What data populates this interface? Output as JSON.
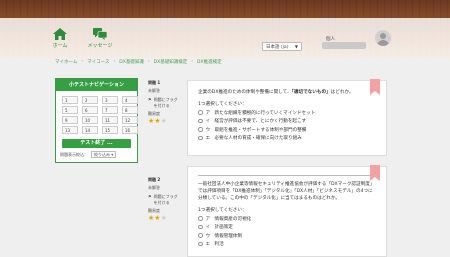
{
  "header": {
    "home_label": "ホーム",
    "message_label": "メッセージ",
    "language": "日本語 (ja)",
    "user_label": "個人"
  },
  "breadcrumb": [
    "マイホーム",
    "マイコース",
    "DX基礎知識",
    "DX基礎知識検定",
    "DX推進検定"
  ],
  "nav": {
    "title": "小テストナビゲーション",
    "cells": [
      "1",
      "2",
      "3",
      "4",
      "5",
      "6",
      "7",
      "8",
      "9",
      "10",
      "11",
      "12",
      "13",
      "14",
      "15",
      "16"
    ],
    "end_button": "テスト終了 ...",
    "filter_label": "問題表示絞込：",
    "filter_value": "絞り込み"
  },
  "questions": [
    {
      "number": "問題 1",
      "status": "未解答",
      "flag": "問題にフラグを付ける",
      "difficulty_label": "難易度",
      "stars": 2,
      "text_before": "企業のDX推進のための体制や整備に関して、",
      "text_bold": "「適切でないもの」",
      "text_after": "はどれか。",
      "choose": "1つ選択してください：",
      "options": [
        {
          "key": "ア",
          "text": "新たな組織を積極的に行っていくマインドセット"
        },
        {
          "key": "イ",
          "text": "経営が評価は不要で、とにかく行動を起こす"
        },
        {
          "key": "ウ",
          "text": "取組を推進・サポートする体制や部門の整備"
        },
        {
          "key": "エ",
          "text": "必要な人材の育成・確保に向けた取り組み"
        }
      ]
    },
    {
      "number": "問題 2",
      "status": "未解答",
      "flag": "問題にフラグを付ける",
      "difficulty_label": "難易度",
      "stars": 2,
      "text": "一般社団法人中小企業等情報セキュリティ推進協会が評価する「DXマーク認証制度」では評価項目を「DX推進体制」「デジタル化」「DX人材」「ビジネスモデル」の4つに分類している。この中の「デジタル化」に当てはまるものはどれか。",
      "choose": "1つ選択してください：",
      "options": [
        {
          "key": "ア",
          "text": "情報資産の可視化"
        },
        {
          "key": "イ",
          "text": "計画策定"
        },
        {
          "key": "ウ",
          "text": "情報管理体制"
        },
        {
          "key": "エ",
          "text": "利活"
        }
      ]
    }
  ],
  "colors": {
    "accent": "#35a043",
    "star": "#e2a600",
    "ribbon": "#f2a2a2"
  }
}
